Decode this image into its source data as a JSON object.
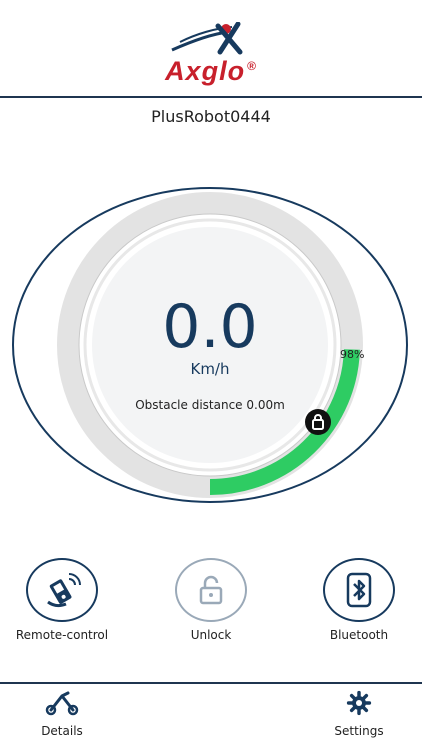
{
  "brand": {
    "name": "Axglo",
    "registered": "®",
    "colors": {
      "red": "#c8202c",
      "navy": "#173a5e"
    }
  },
  "device": {
    "name": "PlusRobot0444"
  },
  "dashboard": {
    "speed": "0.0",
    "speed_unit": "Km/h",
    "obstacle_text": "Obstacle distance 0.00m",
    "battery_label": "98%",
    "battery_level": 0.98,
    "battery_color": "#2ecc63",
    "lock_icon": "lock-icon"
  },
  "actions": [
    {
      "label": "Remote-control",
      "icon": "remote-control-icon"
    },
    {
      "label": "Unlock",
      "icon": "unlock-icon"
    },
    {
      "label": "Bluetooth",
      "icon": "bluetooth-icon"
    }
  ],
  "tabs": [
    {
      "label": "Details",
      "icon": "scooter-icon"
    },
    {
      "label": "Settings",
      "icon": "gear-icon"
    }
  ]
}
